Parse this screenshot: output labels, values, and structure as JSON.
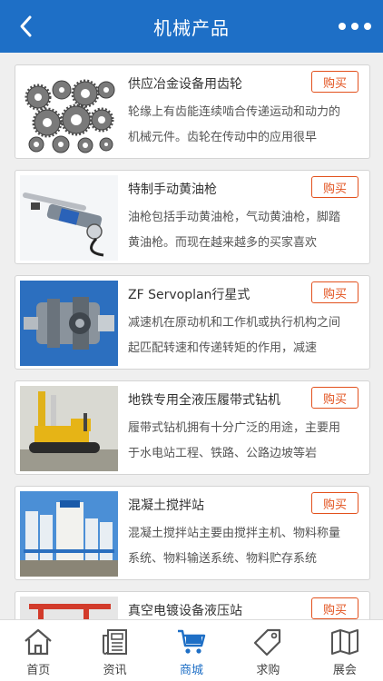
{
  "header": {
    "title": "机械产品"
  },
  "products": [
    {
      "name": "供应冶金设备用齿轮",
      "buy_label": "购买",
      "description": "轮缘上有齿能连续啮合传递运动和动力的机械元件。齿轮在传动中的应用很早",
      "image": "gears"
    },
    {
      "name": "特制手动黄油枪",
      "buy_label": "购买",
      "description": "油枪包括手动黄油枪，气动黄油枪，脚踏黄油枪。而现在越来越多的买家喜欢",
      "image": "grease-gun"
    },
    {
      "name": "ZF Servoplan行星式",
      "buy_label": "购买",
      "description": "减速机在原动机和工作机或执行机构之间起匹配转速和传递转矩的作用，减速",
      "image": "gearbox"
    },
    {
      "name": "地铁专用全液压履带式钻机",
      "buy_label": "购买",
      "description": "履带式钻机拥有十分广泛的用途，主要用于水电站工程、铁路、公路边坡等岩",
      "image": "drill-rig"
    },
    {
      "name": "混凝土搅拌站",
      "buy_label": "购买",
      "description": "混凝土搅拌站主要由搅拌主机、物料称量系统、物料输送系统、物料贮存系统",
      "image": "concrete-plant"
    },
    {
      "name": "真空电镀设备液压站",
      "buy_label": "购买",
      "description": "",
      "image": "hydraulic-station"
    }
  ],
  "tabbar": {
    "items": [
      {
        "label": "首页",
        "icon": "home-icon",
        "active": false
      },
      {
        "label": "资讯",
        "icon": "news-icon",
        "active": false
      },
      {
        "label": "商城",
        "icon": "cart-icon",
        "active": true
      },
      {
        "label": "求购",
        "icon": "tag-icon",
        "active": false
      },
      {
        "label": "展会",
        "icon": "map-icon",
        "active": false
      }
    ]
  },
  "colors": {
    "header_bg": "#1e6fc6",
    "buy_accent": "#e2511d",
    "active_tab": "#1e6fc6"
  }
}
